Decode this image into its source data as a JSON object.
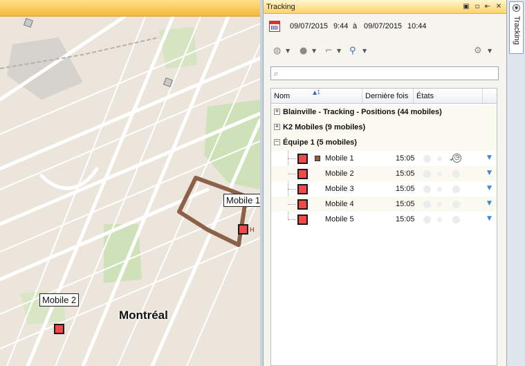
{
  "map": {
    "labels": [
      "Mobile 1",
      "Mobile 2",
      "Montréal"
    ],
    "marker_suffix": "H"
  },
  "panel": {
    "title": "Tracking",
    "header_buttons": [
      "▣",
      "▫",
      "⇤",
      "✕"
    ],
    "date": {
      "start_date": "09/07/2015",
      "start_time": "9:44",
      "separator": "à",
      "end_date": "09/07/2015",
      "end_time": "10:44"
    },
    "search": {
      "placeholder": "",
      "value": ""
    },
    "grid": {
      "columns": [
        "Nom",
        "Dernière fois",
        "États"
      ],
      "sort_indicator": "▲1",
      "groups": [
        {
          "label": "Blainville - Tracking - Positions (44 mobiles)",
          "expander": "+"
        },
        {
          "label": "K2 Mobiles (9 mobiles)",
          "expander": "+"
        },
        {
          "label": "Équipe 1 (5 mobiles)",
          "expander": "−"
        }
      ],
      "mobiles": [
        {
          "name": "Mobile 1",
          "time": "15:05"
        },
        {
          "name": "Mobile 2",
          "time": "15:05"
        },
        {
          "name": "Mobile 3",
          "time": "15:05"
        },
        {
          "name": "Mobile 4",
          "time": "15:05"
        },
        {
          "name": "Mobile 5",
          "time": "15:05"
        }
      ]
    },
    "toolbar_icons": [
      "target-icon",
      "circle-icon",
      "route-icon",
      "tree-icon",
      "settings-icon"
    ]
  },
  "side_tab": {
    "label": "Tracking"
  },
  "colors": {
    "marker": "#ef4a4a",
    "trail": "#8c6148",
    "accent": "#3a88d8",
    "header_gold": "#ffd36a"
  }
}
